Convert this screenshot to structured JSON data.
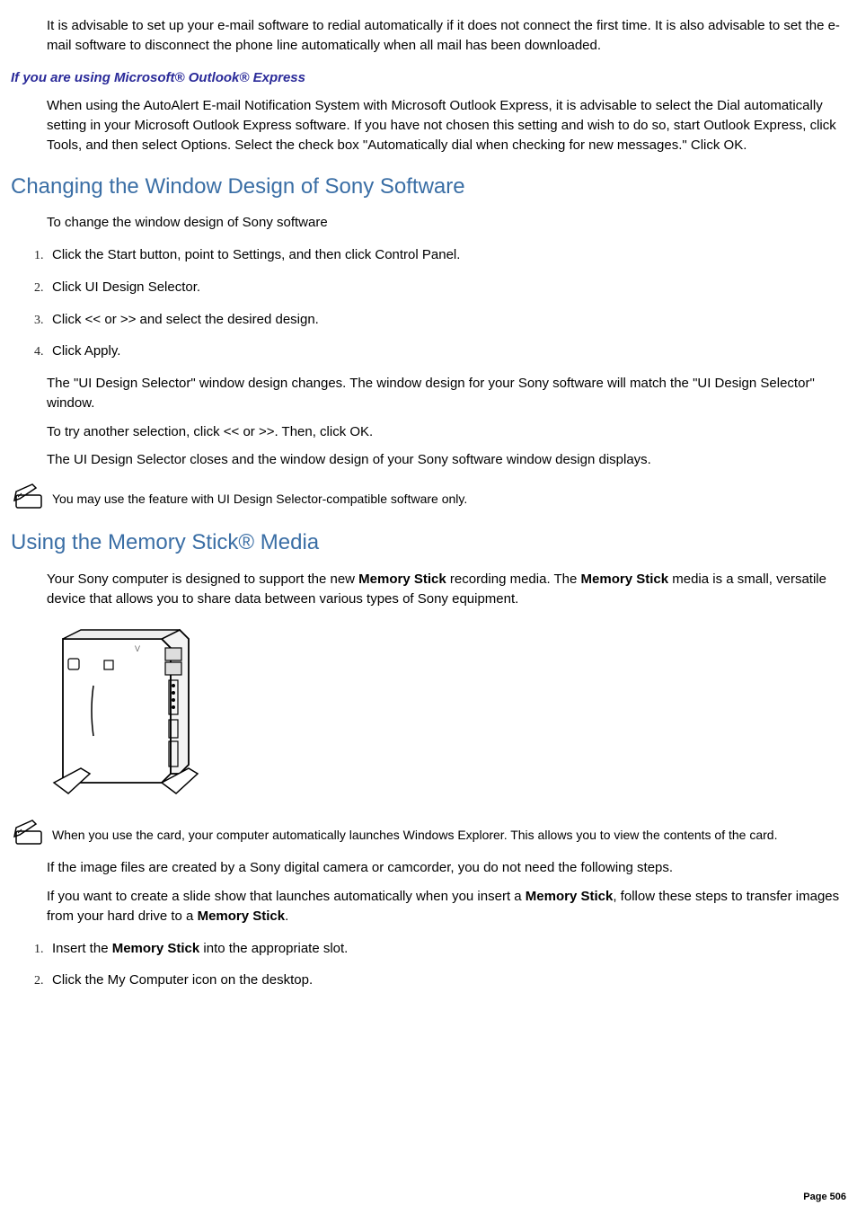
{
  "p_intro": "It is advisable to set up your e-mail software to redial automatically if it does not connect the first time. It is also advisable to set the e-mail software to disconnect the phone line automatically when all mail has been downloaded.",
  "subhead_outlook": "If you are using Microsoft® Outlook® Express",
  "p_outlook": "When using the AutoAlert E-mail Notification System with Microsoft Outlook Express, it is advisable to select the Dial automatically setting in your Microsoft Outlook Express software. If you have not chosen this setting and wish to do so, start Outlook Express, click Tools, and then select Options. Select the check box \"Automatically dial when checking for new messages.\" Click OK.",
  "h2_changing": "Changing the Window Design of Sony Software",
  "p_tochange": "To change the window design of Sony software",
  "ol1": {
    "i1": "Click the Start button, point to Settings, and then click Control Panel.",
    "i2": "Click UI Design Selector.",
    "i3": "Click << or >> and select the desired design.",
    "i4": "Click Apply."
  },
  "p_ui1": "The \"UI Design Selector\" window design changes. The window design for your Sony software will match the \"UI Design Selector\" window.",
  "p_ui2": "To try another selection, click << or >>. Then, click OK.",
  "p_ui3": "The UI Design Selector closes and the window design of your Sony software window design displays.",
  "note1": "You may use the feature with UI Design Selector-compatible software only.",
  "h2_memstick": "Using the Memory Stick® Media",
  "p_mem_intro_a": "Your Sony computer is designed to support the new ",
  "b_mem1": "Memory Stick",
  "p_mem_intro_b": " recording media. The ",
  "b_mem2": "Memory Stick",
  "p_mem_intro_c": " media is a small, versatile device that allows you to share data between various types of Sony equipment.",
  "note2": "When you use the card, your computer automatically launches Windows Explorer. This allows you to view the contents of the card.",
  "p_mem_if": "If the image files are created by a Sony digital camera or camcorder, you do not need the following steps.",
  "p_mem_slide_a": "If you want to create a slide show that launches automatically when you insert a ",
  "b_mem3": "Memory Stick",
  "p_mem_slide_b": ", follow these steps to transfer images from your hard drive to a ",
  "b_mem4": "Memory Stick",
  "p_mem_slide_c": ".",
  "ol2": {
    "i1_a": "Insert the ",
    "i1_b": "Memory Stick",
    "i1_c": " into the appropriate slot.",
    "i2": "Click the My Computer icon on the desktop."
  },
  "page_label": "Page 506"
}
